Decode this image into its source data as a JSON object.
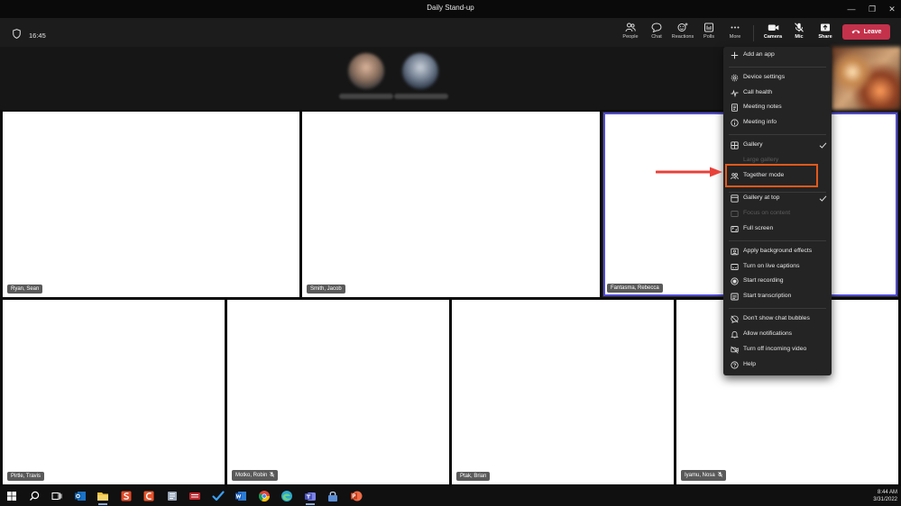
{
  "window": {
    "title": "Daily Stand-up"
  },
  "toolbar": {
    "timer": "16:45",
    "buttons": [
      {
        "label": "People"
      },
      {
        "label": "Chat"
      },
      {
        "label": "Reactions"
      },
      {
        "label": "Polls"
      },
      {
        "label": "More"
      },
      {
        "label": "Camera"
      },
      {
        "label": "Mic"
      },
      {
        "label": "Share"
      }
    ],
    "leave_label": "Leave",
    "accent": "#c4314b"
  },
  "participants": [
    {
      "name": "Ryan, Sean",
      "muted": false
    },
    {
      "name": "Smith, Jacob",
      "muted": false
    },
    {
      "name": "Fantasma, Rebecca",
      "muted": false,
      "active_speaker": true
    },
    {
      "name": "Pirtle, Travis",
      "muted": false
    },
    {
      "name": "Motko, Robin",
      "muted": true
    },
    {
      "name": "Ptak, Brian",
      "muted": false
    },
    {
      "name": "Iyamu, Nosa",
      "muted": true
    }
  ],
  "more_menu": {
    "sections": [
      [
        {
          "label": "Add an app",
          "icon": "plus-icon"
        }
      ],
      [
        {
          "label": "Device settings",
          "icon": "gear-icon"
        },
        {
          "label": "Call health",
          "icon": "pulse-icon"
        },
        {
          "label": "Meeting notes",
          "icon": "notes-icon"
        },
        {
          "label": "Meeting info",
          "icon": "info-icon"
        }
      ],
      [
        {
          "label": "Gallery",
          "icon": "grid-icon",
          "checked": true
        },
        {
          "label": "Large gallery",
          "icon": "large-grid-icon",
          "disabled": true
        },
        {
          "label": "Together mode",
          "icon": "together-icon",
          "highlighted": true
        }
      ],
      [
        {
          "label": "Gallery at top",
          "icon": "gallery-top-icon",
          "checked": true
        },
        {
          "label": "Focus on content",
          "icon": "focus-icon",
          "disabled": true
        },
        {
          "label": "Full screen",
          "icon": "fullscreen-icon"
        }
      ],
      [
        {
          "label": "Apply background effects",
          "icon": "background-icon"
        },
        {
          "label": "Turn on live captions",
          "icon": "captions-icon"
        },
        {
          "label": "Start recording",
          "icon": "record-icon"
        },
        {
          "label": "Start transcription",
          "icon": "transcript-icon"
        }
      ],
      [
        {
          "label": "Don't show chat bubbles",
          "icon": "no-bubbles-icon"
        },
        {
          "label": "Allow notifications",
          "icon": "bell-icon"
        },
        {
          "label": "Turn off incoming video",
          "icon": "video-off-icon"
        },
        {
          "label": "Help",
          "icon": "help-icon"
        }
      ]
    ],
    "highlight_color": "#e2591c",
    "arrow_color": "#e8413a"
  },
  "taskbar": {
    "time": "8:44 AM",
    "date": "3/31/2022",
    "apps": [
      "windows-start-icon",
      "search-icon",
      "task-view-icon",
      "outlook-icon",
      "file-explorer-icon",
      "snagit-icon",
      "camtasia-icon",
      "onenote-icon",
      "app-icon",
      "todo-icon",
      "word-icon",
      "chrome-icon",
      "edge-icon",
      "teams-icon",
      "lock-app-icon",
      "powerpoint-icon"
    ]
  }
}
